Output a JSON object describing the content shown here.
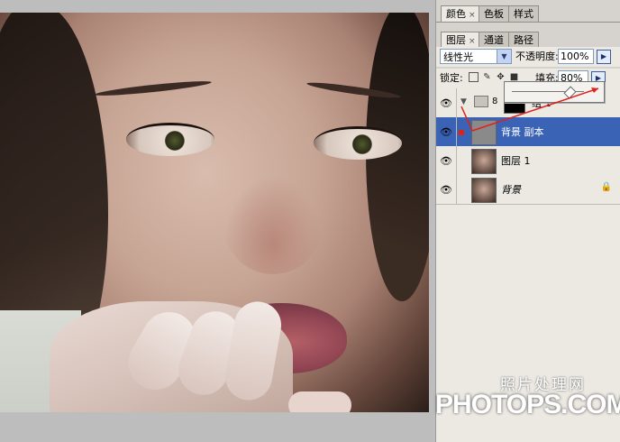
{
  "panel": {
    "top_tabs": [
      {
        "label": "颜色",
        "close": "×"
      },
      {
        "label": "色板"
      },
      {
        "label": "样式"
      }
    ],
    "layer_tabs": [
      {
        "label": "图层",
        "close": "×"
      },
      {
        "label": "通道"
      },
      {
        "label": "路径"
      }
    ],
    "blend_mode": "线性光",
    "opacity_label": "不透明度:",
    "opacity_value": "100%",
    "lock_label": "锁定:",
    "fill_label": "填充:",
    "fill_value": "80%",
    "fill_slider_fraction": 0.8
  },
  "layers": [
    {
      "name": "组 1",
      "type": "group"
    },
    {
      "name": "背景 副本",
      "selected": true
    },
    {
      "name": "图层 1"
    },
    {
      "name": "背景",
      "locked": true
    }
  ],
  "watermark": {
    "line1": "照片处理网",
    "line2": "PHOTOPS.COM"
  },
  "colors": {
    "selected_layer": "#3a63b6",
    "annotation_arrow": "#e0201a"
  }
}
